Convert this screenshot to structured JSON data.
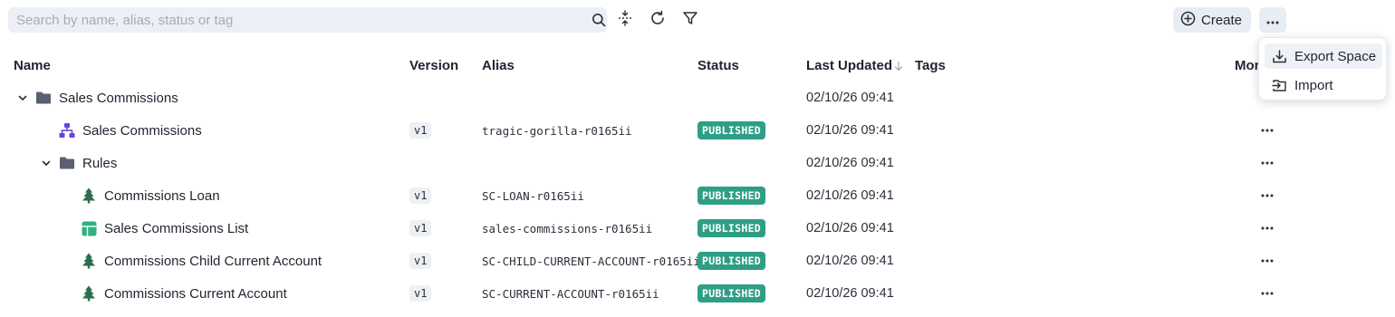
{
  "search": {
    "placeholder": "Search by name, alias, status or tag"
  },
  "toolbar": {
    "create_label": "Create"
  },
  "columns": {
    "name": "Name",
    "version": "Version",
    "alias": "Alias",
    "status": "Status",
    "last_updated": "Last Updated",
    "tags": "Tags",
    "more": "More"
  },
  "rows": [
    {
      "level": 0,
      "type": "folder",
      "expanded": true,
      "icon": "folder-icon",
      "name": "Sales Commissions",
      "version": "",
      "alias": "",
      "status": "",
      "updated": "02/10/26 09:41",
      "has_more": false
    },
    {
      "level": 1,
      "type": "flow",
      "icon": "hierarchy-icon",
      "name": "Sales Commissions",
      "version": "v1",
      "alias": "tragic-gorilla-r0165ii",
      "status": "PUBLISHED",
      "updated": "02/10/26 09:41",
      "has_more": true
    },
    {
      "level": 1,
      "type": "folder",
      "expanded": true,
      "icon": "folder-icon",
      "name": "Rules",
      "version": "",
      "alias": "",
      "status": "",
      "updated": "02/10/26 09:41",
      "has_more": true
    },
    {
      "level": 2,
      "type": "tree",
      "icon": "tree-icon",
      "name": "Commissions Loan",
      "version": "v1",
      "alias": "SC-LOAN-r0165ii",
      "status": "PUBLISHED",
      "updated": "02/10/26 09:41",
      "has_more": true
    },
    {
      "level": 2,
      "type": "table",
      "icon": "table-icon",
      "name": "Sales Commissions List",
      "version": "v1",
      "alias": "sales-commissions-r0165ii",
      "status": "PUBLISHED",
      "updated": "02/10/26 09:41",
      "has_more": true
    },
    {
      "level": 2,
      "type": "tree",
      "icon": "tree-icon",
      "name": "Commissions Child Current Account",
      "version": "v1",
      "alias": "SC-CHILD-CURRENT-ACCOUNT-r0165ii",
      "status": "PUBLISHED",
      "updated": "02/10/26 09:41",
      "has_more": true
    },
    {
      "level": 2,
      "type": "tree",
      "icon": "tree-icon",
      "name": "Commissions Current Account",
      "version": "v1",
      "alias": "SC-CURRENT-ACCOUNT-r0165ii",
      "status": "PUBLISHED",
      "updated": "02/10/26 09:41",
      "has_more": true
    }
  ],
  "menu": {
    "items": [
      {
        "label": "Export Space",
        "icon": "download-icon"
      },
      {
        "label": "Import",
        "icon": "import-icon"
      }
    ]
  },
  "colors": {
    "status_published": "#2f9e87",
    "folder": "#5a6070",
    "hierarchy": "#6b3fe0",
    "tree": "#2c6e4f",
    "table": "#2fb27d"
  }
}
